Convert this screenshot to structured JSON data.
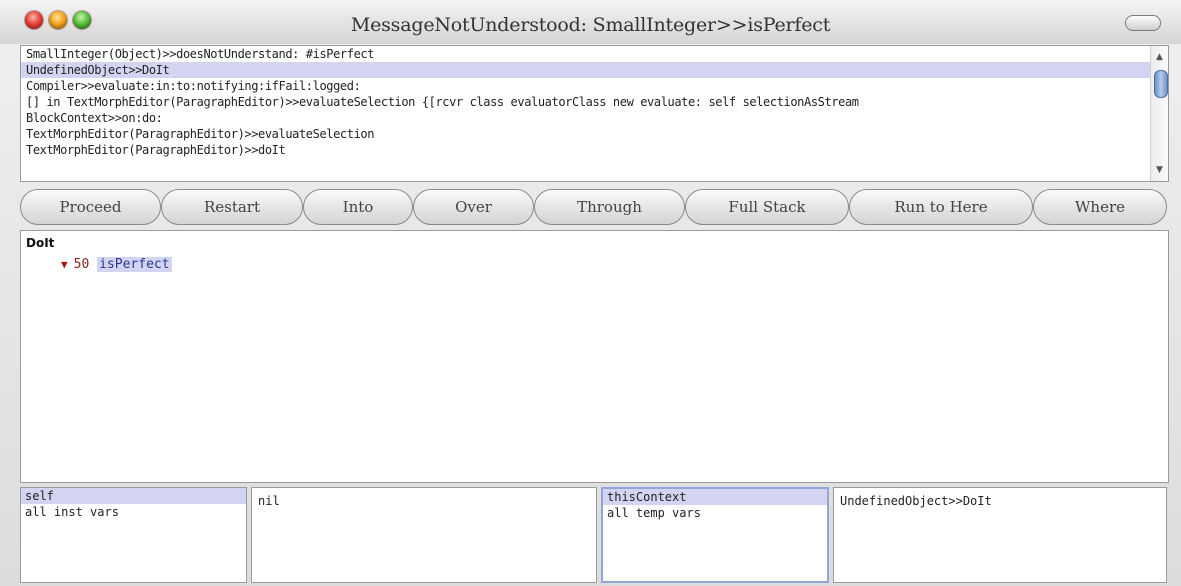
{
  "window": {
    "title": "MessageNotUnderstood: SmallInteger>>isPerfect"
  },
  "stack": {
    "items": [
      {
        "label": "SmallInteger(Object)>>doesNotUnderstand: #isPerfect",
        "selected": false
      },
      {
        "label": "UndefinedObject>>DoIt",
        "selected": true
      },
      {
        "label": "Compiler>>evaluate:in:to:notifying:ifFail:logged:",
        "selected": false
      },
      {
        "label": "[] in TextMorphEditor(ParagraphEditor)>>evaluateSelection {[rcvr class evaluatorClass new    evaluate: self selectionAsStream",
        "selected": false
      },
      {
        "label": "BlockContext>>on:do:",
        "selected": false
      },
      {
        "label": "TextMorphEditor(ParagraphEditor)>>evaluateSelection",
        "selected": false
      },
      {
        "label": "TextMorphEditor(ParagraphEditor)>>doIt",
        "selected": false
      }
    ]
  },
  "buttons": [
    "Proceed",
    "Restart",
    "Into",
    "Over",
    "Through",
    "Full Stack",
    "Run to Here",
    "Where"
  ],
  "code": {
    "title": "DoIt",
    "marker": "▼",
    "number": "50",
    "selector": "isPerfect"
  },
  "receiver_inspector": {
    "fields": [
      "self",
      "all inst vars"
    ],
    "value": "nil"
  },
  "context_inspector": {
    "fields": [
      "thisContext",
      "all temp vars"
    ],
    "value": "UndefinedObject>>DoIt"
  },
  "colors": {
    "selection": "#d2d4f2",
    "focus_border": "#8fa8d8"
  }
}
